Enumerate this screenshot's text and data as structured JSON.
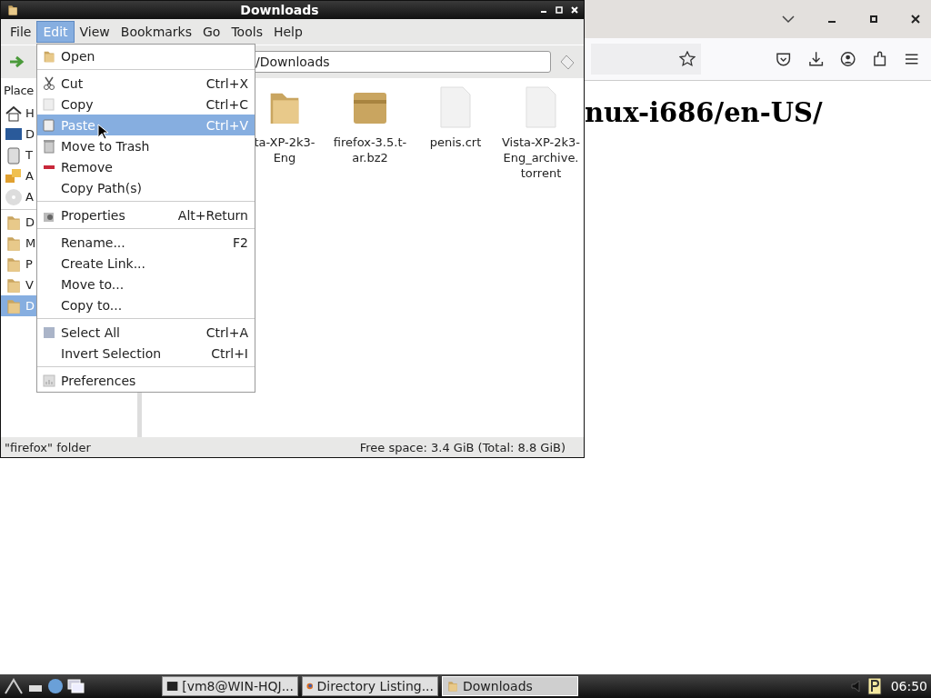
{
  "browser": {
    "heading": "nux-i686/en-US/"
  },
  "window": {
    "title": "Downloads"
  },
  "menubar": [
    {
      "label": "File",
      "selected": false
    },
    {
      "label": "Edit",
      "selected": true
    },
    {
      "label": "View",
      "selected": false
    },
    {
      "label": "Bookmarks",
      "selected": false
    },
    {
      "label": "Go",
      "selected": false
    },
    {
      "label": "Tools",
      "selected": false
    },
    {
      "label": "Help",
      "selected": false
    }
  ],
  "location": {
    "value": "/Downloads"
  },
  "sidebar": {
    "header": "Place",
    "items": [
      {
        "label": "H",
        "selected": false
      },
      {
        "label": "D",
        "selected": false
      },
      {
        "label": "T",
        "selected": false
      },
      {
        "label": "A",
        "selected": false
      },
      {
        "label": "A",
        "selected": false
      },
      {
        "kind": "separator"
      },
      {
        "label": "D",
        "selected": false
      },
      {
        "label": "M",
        "selected": false
      },
      {
        "label": "P",
        "selected": false
      },
      {
        "label": "V",
        "selected": false
      },
      {
        "label": "D",
        "selected": true
      }
    ]
  },
  "files": [
    {
      "kind": "folder",
      "name_lines": [
        "ta-XP-2k3-",
        "Eng"
      ]
    },
    {
      "kind": "archive",
      "name_lines": [
        "firefox-3.5.t-",
        "ar.bz2"
      ]
    },
    {
      "kind": "file",
      "name_lines": [
        "penis.crt"
      ]
    },
    {
      "kind": "file",
      "name_lines": [
        "Vista-XP-2k3-",
        "Eng_archive.",
        "torrent"
      ]
    }
  ],
  "status_bar": {
    "left": "\"firefox\" folder",
    "right": "Free space: 3.4 GiB (Total: 8.8 GiB)"
  },
  "edit_menu": [
    {
      "kind": "item",
      "label": "Open",
      "selected": false
    },
    {
      "kind": "separator"
    },
    {
      "kind": "item",
      "label": "Cut",
      "shortcut": "Ctrl+X",
      "selected": false
    },
    {
      "kind": "item",
      "label": "Copy",
      "shortcut": "Ctrl+C",
      "selected": false
    },
    {
      "kind": "item",
      "label": "Paste",
      "shortcut": "Ctrl+V",
      "selected": true
    },
    {
      "kind": "item",
      "label": "Move to Trash",
      "selected": false
    },
    {
      "kind": "item",
      "label": "Remove",
      "selected": false
    },
    {
      "kind": "item",
      "label": "Copy Path(s)",
      "selected": false
    },
    {
      "kind": "separator"
    },
    {
      "kind": "item",
      "label": "Properties",
      "shortcut": "Alt+Return",
      "selected": false
    },
    {
      "kind": "separator"
    },
    {
      "kind": "item",
      "label": "Rename...",
      "shortcut": "F2",
      "selected": false
    },
    {
      "kind": "item",
      "label": "Create Link...",
      "selected": false
    },
    {
      "kind": "item",
      "label": "Move to...",
      "selected": false
    },
    {
      "kind": "item",
      "label": "Copy to...",
      "selected": false
    },
    {
      "kind": "separator"
    },
    {
      "kind": "item",
      "label": "Select All",
      "shortcut": "Ctrl+A",
      "selected": false
    },
    {
      "kind": "item",
      "label": "Invert Selection",
      "shortcut": "Ctrl+I",
      "selected": false
    },
    {
      "kind": "separator"
    },
    {
      "kind": "item",
      "label": "Preferences",
      "selected": false
    }
  ],
  "taskbar": {
    "tasks": [
      {
        "label": "[vm8@WIN-HQJ...",
        "selected": false
      },
      {
        "label": "Directory Listing...",
        "selected": false
      },
      {
        "label": "Downloads",
        "selected": true
      }
    ],
    "clock": "06:50"
  }
}
